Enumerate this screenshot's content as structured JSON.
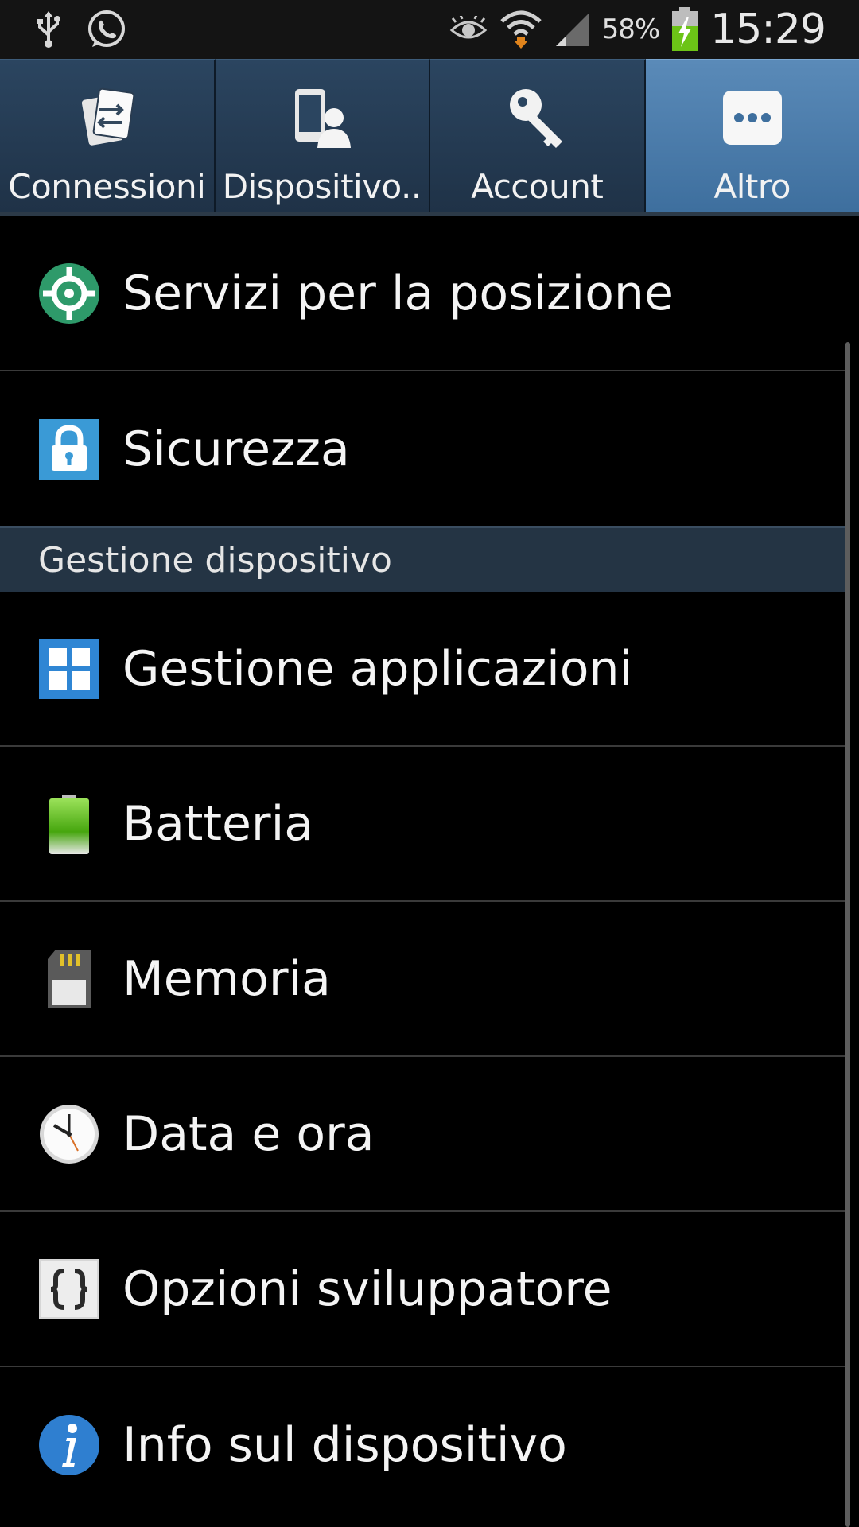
{
  "status_bar": {
    "battery_percent": "58%",
    "time": "15:29",
    "icons": [
      "usb-icon",
      "whatsapp-icon",
      "eye-icon",
      "wifi-icon",
      "signal-icon",
      "battery-charging-icon"
    ]
  },
  "tabs": [
    {
      "label": "Connessioni",
      "icon": "connections-icon",
      "active": false
    },
    {
      "label": "Dispositivo..",
      "icon": "device-icon",
      "active": false
    },
    {
      "label": "Account",
      "icon": "key-icon",
      "active": false
    },
    {
      "label": "Altro",
      "icon": "more-icon",
      "active": true
    }
  ],
  "list": {
    "items_top": [
      {
        "label": "Servizi per la posizione",
        "icon": "location-icon"
      },
      {
        "label": "Sicurezza",
        "icon": "lock-icon"
      }
    ],
    "section_header": "Gestione dispositivo",
    "items_bottom": [
      {
        "label": "Gestione applicazioni",
        "icon": "apps-grid-icon"
      },
      {
        "label": "Batteria",
        "icon": "battery-icon"
      },
      {
        "label": "Memoria",
        "icon": "sd-card-icon"
      },
      {
        "label": "Data e ora",
        "icon": "clock-icon"
      },
      {
        "label": "Opzioni sviluppatore",
        "icon": "braces-icon"
      },
      {
        "label": "Info sul dispositivo",
        "icon": "info-icon"
      }
    ]
  },
  "colors": {
    "active_tab": "#4a7fb0",
    "tab": "#24394f",
    "section_header": "#243444",
    "location_green": "#2e9a6a",
    "lock_blue": "#3a9ad6",
    "apps_blue": "#2f86d4",
    "battery_green": "#5cc41c",
    "info_blue": "#2f7fd0"
  }
}
